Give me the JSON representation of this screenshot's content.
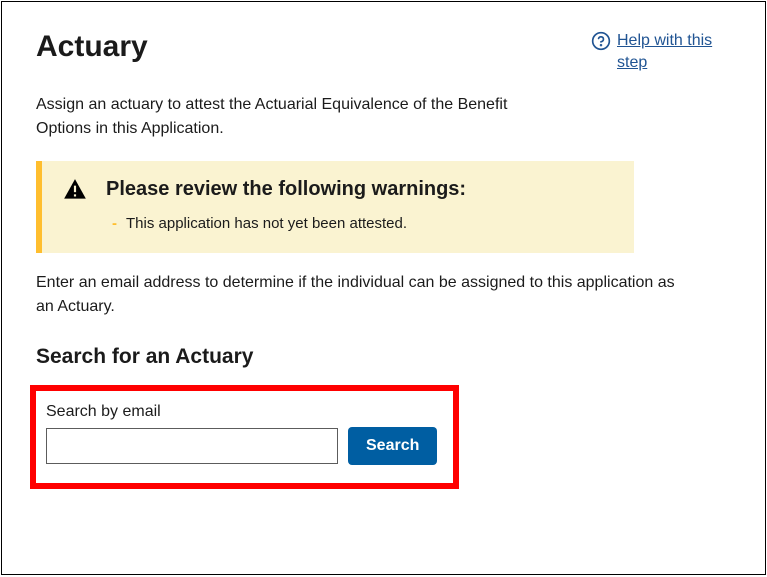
{
  "header": {
    "title": "Actuary",
    "help_link_text": " Help with this step"
  },
  "intro": "Assign an actuary to attest the Actuarial Equivalence of the Benefit Options in this Application.",
  "warning": {
    "title": "Please review the following warnings:",
    "items": [
      "This application has not yet been attested."
    ]
  },
  "instruction": "Enter an email address to determine if the individual can be assigned to this application as an Actuary.",
  "search": {
    "heading": "Search for an Actuary",
    "field_label": "Search by email",
    "input_value": "",
    "button_label": "Search"
  },
  "colors": {
    "link": "#205493",
    "warning_bg": "#faf3d1",
    "warning_border": "#ffbe2e",
    "primary_button": "#005ea2",
    "highlight": "#ff0000"
  }
}
